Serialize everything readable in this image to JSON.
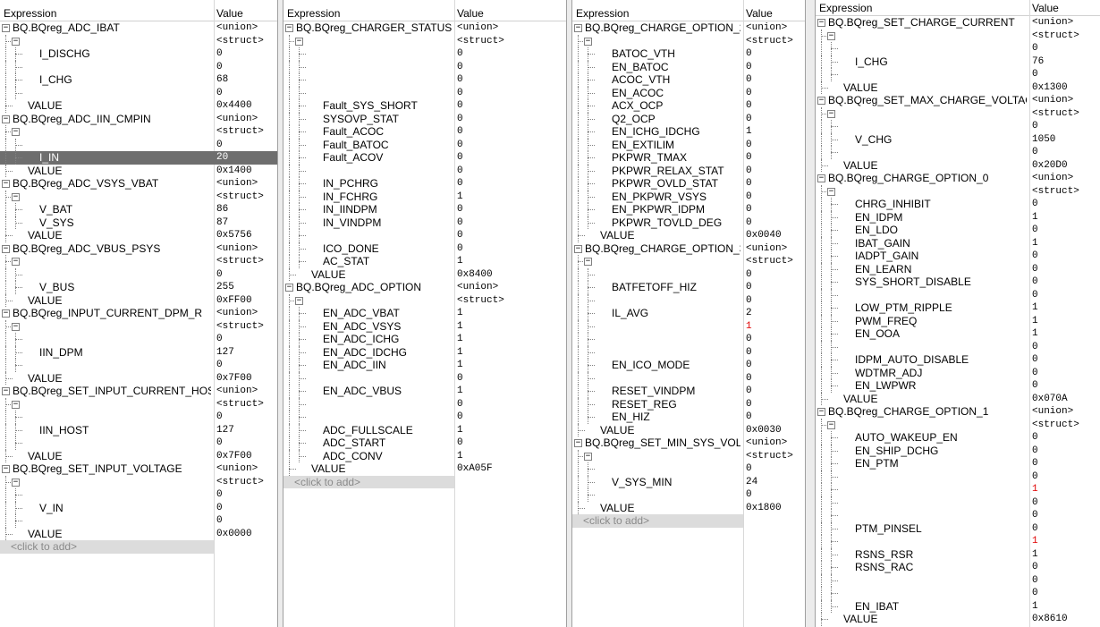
{
  "headers": {
    "expression": "Expression",
    "value": "Value"
  },
  "add_label": "<click to add>",
  "panels": [
    {
      "rows": [
        {
          "d": 0,
          "t": "g",
          "e": "BQ.BQreg_ADC_IBAT",
          "v": "<union>"
        },
        {
          "d": 1,
          "t": "g",
          "e": "",
          "v": "<struct>"
        },
        {
          "d": 2,
          "t": "l",
          "e": "I_DISCHG",
          "v": "0"
        },
        {
          "d": 2,
          "t": "l",
          "e": "",
          "v": "0"
        },
        {
          "d": 2,
          "t": "l",
          "e": "I_CHG",
          "v": "68"
        },
        {
          "d": 2,
          "t": "l",
          "e": "",
          "v": "0"
        },
        {
          "d": 1,
          "t": "l",
          "e": "VALUE",
          "v": "0x4400"
        },
        {
          "d": 0,
          "t": "g",
          "e": "BQ.BQreg_ADC_IIN_CMPIN",
          "v": "<union>"
        },
        {
          "d": 1,
          "t": "g",
          "e": "",
          "v": "<struct>"
        },
        {
          "d": 2,
          "t": "l",
          "e": "",
          "v": "0"
        },
        {
          "d": 2,
          "t": "l",
          "e": "I_IN",
          "v": "20",
          "sel": true
        },
        {
          "d": 1,
          "t": "l",
          "e": "VALUE",
          "v": "0x1400"
        },
        {
          "d": 0,
          "t": "g",
          "e": "BQ.BQreg_ADC_VSYS_VBAT",
          "v": "<union>"
        },
        {
          "d": 1,
          "t": "g",
          "e": "",
          "v": "<struct>"
        },
        {
          "d": 2,
          "t": "l",
          "e": "V_BAT",
          "v": "86"
        },
        {
          "d": 2,
          "t": "l",
          "e": "V_SYS",
          "v": "87"
        },
        {
          "d": 1,
          "t": "l",
          "e": "VALUE",
          "v": "0x5756"
        },
        {
          "d": 0,
          "t": "g",
          "e": "BQ.BQreg_ADC_VBUS_PSYS",
          "v": "<union>"
        },
        {
          "d": 1,
          "t": "g",
          "e": "",
          "v": "<struct>"
        },
        {
          "d": 2,
          "t": "l",
          "e": "",
          "v": "0"
        },
        {
          "d": 2,
          "t": "l",
          "e": "V_BUS",
          "v": "255"
        },
        {
          "d": 1,
          "t": "l",
          "e": "VALUE",
          "v": "0xFF00"
        },
        {
          "d": 0,
          "t": "g",
          "e": "BQ.BQreg_INPUT_CURRENT_DPM_R",
          "v": "<union>"
        },
        {
          "d": 1,
          "t": "g",
          "e": "",
          "v": "<struct>"
        },
        {
          "d": 2,
          "t": "l",
          "e": "",
          "v": "0"
        },
        {
          "d": 2,
          "t": "l",
          "e": "IIN_DPM",
          "v": "127"
        },
        {
          "d": 2,
          "t": "l",
          "e": "",
          "v": "0"
        },
        {
          "d": 1,
          "t": "l",
          "e": "VALUE",
          "v": "0x7F00"
        },
        {
          "d": 0,
          "t": "g",
          "e": "BQ.BQreg_SET_INPUT_CURRENT_HOST",
          "v": "<union>"
        },
        {
          "d": 1,
          "t": "g",
          "e": "",
          "v": "<struct>"
        },
        {
          "d": 2,
          "t": "l",
          "e": "",
          "v": "0"
        },
        {
          "d": 2,
          "t": "l",
          "e": "IIN_HOST",
          "v": "127"
        },
        {
          "d": 2,
          "t": "l",
          "e": "",
          "v": "0"
        },
        {
          "d": 1,
          "t": "l",
          "e": "VALUE",
          "v": "0x7F00"
        },
        {
          "d": 0,
          "t": "g",
          "e": "BQ.BQreg_SET_INPUT_VOLTAGE",
          "v": "<union>"
        },
        {
          "d": 1,
          "t": "g",
          "e": "",
          "v": "<struct>"
        },
        {
          "d": 2,
          "t": "l",
          "e": "",
          "v": "0"
        },
        {
          "d": 2,
          "t": "l",
          "e": "V_IN",
          "v": "0"
        },
        {
          "d": 2,
          "t": "l",
          "e": "",
          "v": "0"
        },
        {
          "d": 1,
          "t": "l",
          "e": "VALUE",
          "v": "0x0000"
        }
      ]
    },
    {
      "rows": [
        {
          "d": 0,
          "t": "g",
          "e": "BQ.BQreg_CHARGER_STATUS",
          "v": "<union>"
        },
        {
          "d": 1,
          "t": "g",
          "e": "",
          "v": "<struct>"
        },
        {
          "d": 2,
          "t": "l",
          "e": "",
          "v": "0"
        },
        {
          "d": 2,
          "t": "l",
          "e": "",
          "v": "0"
        },
        {
          "d": 2,
          "t": "l",
          "e": "",
          "v": "0"
        },
        {
          "d": 2,
          "t": "l",
          "e": "",
          "v": "0"
        },
        {
          "d": 2,
          "t": "l",
          "e": "Fault_SYS_SHORT",
          "v": "0"
        },
        {
          "d": 2,
          "t": "l",
          "e": "SYSOVP_STAT",
          "v": "0"
        },
        {
          "d": 2,
          "t": "l",
          "e": "Fault_ACOC",
          "v": "0"
        },
        {
          "d": 2,
          "t": "l",
          "e": "Fault_BATOC",
          "v": "0"
        },
        {
          "d": 2,
          "t": "l",
          "e": "Fault_ACOV",
          "v": "0"
        },
        {
          "d": 2,
          "t": "l",
          "e": "",
          "v": "0"
        },
        {
          "d": 2,
          "t": "l",
          "e": "IN_PCHRG",
          "v": "0"
        },
        {
          "d": 2,
          "t": "l",
          "e": "IN_FCHRG",
          "v": "1"
        },
        {
          "d": 2,
          "t": "l",
          "e": "IN_IINDPM",
          "v": "0"
        },
        {
          "d": 2,
          "t": "l",
          "e": "IN_VINDPM",
          "v": "0"
        },
        {
          "d": 2,
          "t": "l",
          "e": "",
          "v": "0"
        },
        {
          "d": 2,
          "t": "l",
          "e": "ICO_DONE",
          "v": "0"
        },
        {
          "d": 2,
          "t": "l",
          "e": "AC_STAT",
          "v": "1"
        },
        {
          "d": 1,
          "t": "l",
          "e": "VALUE",
          "v": "0x8400"
        },
        {
          "d": 0,
          "t": "g",
          "e": "BQ.BQreg_ADC_OPTION",
          "v": "<union>"
        },
        {
          "d": 1,
          "t": "g",
          "e": "",
          "v": "<struct>"
        },
        {
          "d": 2,
          "t": "l",
          "e": "EN_ADC_VBAT",
          "v": "1"
        },
        {
          "d": 2,
          "t": "l",
          "e": "EN_ADC_VSYS",
          "v": "1"
        },
        {
          "d": 2,
          "t": "l",
          "e": "EN_ADC_ICHG",
          "v": "1"
        },
        {
          "d": 2,
          "t": "l",
          "e": "EN_ADC_IDCHG",
          "v": "1"
        },
        {
          "d": 2,
          "t": "l",
          "e": "EN_ADC_IIN",
          "v": "1"
        },
        {
          "d": 2,
          "t": "l",
          "e": "",
          "v": "0"
        },
        {
          "d": 2,
          "t": "l",
          "e": "EN_ADC_VBUS",
          "v": "1"
        },
        {
          "d": 2,
          "t": "l",
          "e": "",
          "v": "0"
        },
        {
          "d": 2,
          "t": "l",
          "e": "",
          "v": "0"
        },
        {
          "d": 2,
          "t": "l",
          "e": "ADC_FULLSCALE",
          "v": "1"
        },
        {
          "d": 2,
          "t": "l",
          "e": "ADC_START",
          "v": "0"
        },
        {
          "d": 2,
          "t": "l",
          "e": "ADC_CONV",
          "v": "1"
        },
        {
          "d": 1,
          "t": "l",
          "e": "VALUE",
          "v": "0xA05F"
        }
      ]
    },
    {
      "rows": [
        {
          "d": 0,
          "t": "g",
          "e": "BQ.BQreg_CHARGE_OPTION_2",
          "v": "<union>"
        },
        {
          "d": 1,
          "t": "g",
          "e": "",
          "v": "<struct>"
        },
        {
          "d": 2,
          "t": "l",
          "e": "BATOC_VTH",
          "v": "0"
        },
        {
          "d": 2,
          "t": "l",
          "e": "EN_BATOC",
          "v": "0"
        },
        {
          "d": 2,
          "t": "l",
          "e": "ACOC_VTH",
          "v": "0"
        },
        {
          "d": 2,
          "t": "l",
          "e": "EN_ACOC",
          "v": "0"
        },
        {
          "d": 2,
          "t": "l",
          "e": "ACX_OCP",
          "v": "0"
        },
        {
          "d": 2,
          "t": "l",
          "e": "Q2_OCP",
          "v": "0"
        },
        {
          "d": 2,
          "t": "l",
          "e": "EN_ICHG_IDCHG",
          "v": "1"
        },
        {
          "d": 2,
          "t": "l",
          "e": "EN_EXTILIM",
          "v": "0"
        },
        {
          "d": 2,
          "t": "l",
          "e": "PKPWR_TMAX",
          "v": "0"
        },
        {
          "d": 2,
          "t": "l",
          "e": "PKPWR_RELAX_STAT",
          "v": "0"
        },
        {
          "d": 2,
          "t": "l",
          "e": "PKPWR_OVLD_STAT",
          "v": "0"
        },
        {
          "d": 2,
          "t": "l",
          "e": "EN_PKPWR_VSYS",
          "v": "0"
        },
        {
          "d": 2,
          "t": "l",
          "e": "EN_PKPWR_IDPM",
          "v": "0"
        },
        {
          "d": 2,
          "t": "l",
          "e": "PKPWR_TOVLD_DEG",
          "v": "0"
        },
        {
          "d": 1,
          "t": "l",
          "e": "VALUE",
          "v": "0x0040"
        },
        {
          "d": 0,
          "t": "g",
          "e": "BQ.BQreg_CHARGE_OPTION_3",
          "v": "<union>"
        },
        {
          "d": 1,
          "t": "g",
          "e": "",
          "v": "<struct>"
        },
        {
          "d": 2,
          "t": "l",
          "e": "",
          "v": "0"
        },
        {
          "d": 2,
          "t": "l",
          "e": "BATFETOFF_HIZ",
          "v": "0"
        },
        {
          "d": 2,
          "t": "l",
          "e": "",
          "v": "0"
        },
        {
          "d": 2,
          "t": "l",
          "e": "IL_AVG",
          "v": "2"
        },
        {
          "d": 2,
          "t": "l",
          "e": "",
          "v": "1",
          "red": true
        },
        {
          "d": 2,
          "t": "l",
          "e": "",
          "v": "0"
        },
        {
          "d": 2,
          "t": "l",
          "e": "",
          "v": "0"
        },
        {
          "d": 2,
          "t": "l",
          "e": "EN_ICO_MODE",
          "v": "0"
        },
        {
          "d": 2,
          "t": "l",
          "e": "",
          "v": "0"
        },
        {
          "d": 2,
          "t": "l",
          "e": "RESET_VINDPM",
          "v": "0"
        },
        {
          "d": 2,
          "t": "l",
          "e": "RESET_REG",
          "v": "0"
        },
        {
          "d": 2,
          "t": "l",
          "e": "EN_HIZ",
          "v": "0"
        },
        {
          "d": 1,
          "t": "l",
          "e": "VALUE",
          "v": "0x0030"
        },
        {
          "d": 0,
          "t": "g",
          "e": "BQ.BQreg_SET_MIN_SYS_VOL...",
          "v": "<union>"
        },
        {
          "d": 1,
          "t": "g",
          "e": "",
          "v": "<struct>"
        },
        {
          "d": 2,
          "t": "l",
          "e": "",
          "v": "0"
        },
        {
          "d": 2,
          "t": "l",
          "e": "V_SYS_MIN",
          "v": "24"
        },
        {
          "d": 2,
          "t": "l",
          "e": "",
          "v": "0"
        },
        {
          "d": 1,
          "t": "l",
          "e": "VALUE",
          "v": "0x1800"
        }
      ]
    },
    {
      "rows": [
        {
          "d": 0,
          "t": "g",
          "e": "BQ.BQreg_SET_CHARGE_CURRENT",
          "v": "<union>"
        },
        {
          "d": 1,
          "t": "g",
          "e": "",
          "v": "<struct>"
        },
        {
          "d": 2,
          "t": "l",
          "e": "",
          "v": "0"
        },
        {
          "d": 2,
          "t": "l",
          "e": "I_CHG",
          "v": "76"
        },
        {
          "d": 2,
          "t": "l",
          "e": "",
          "v": "0"
        },
        {
          "d": 1,
          "t": "l",
          "e": "VALUE",
          "v": "0x1300"
        },
        {
          "d": 0,
          "t": "g",
          "e": "BQ.BQreg_SET_MAX_CHARGE_VOLTAGE",
          "v": "<union>"
        },
        {
          "d": 1,
          "t": "g",
          "e": "",
          "v": "<struct>"
        },
        {
          "d": 2,
          "t": "l",
          "e": "",
          "v": "0"
        },
        {
          "d": 2,
          "t": "l",
          "e": "V_CHG",
          "v": "1050"
        },
        {
          "d": 2,
          "t": "l",
          "e": "",
          "v": "0"
        },
        {
          "d": 1,
          "t": "l",
          "e": "VALUE",
          "v": "0x20D0"
        },
        {
          "d": 0,
          "t": "g",
          "e": "BQ.BQreg_CHARGE_OPTION_0",
          "v": "<union>"
        },
        {
          "d": 1,
          "t": "g",
          "e": "",
          "v": "<struct>"
        },
        {
          "d": 2,
          "t": "l",
          "e": "CHRG_INHIBIT",
          "v": "0"
        },
        {
          "d": 2,
          "t": "l",
          "e": "EN_IDPM",
          "v": "1"
        },
        {
          "d": 2,
          "t": "l",
          "e": "EN_LDO",
          "v": "0"
        },
        {
          "d": 2,
          "t": "l",
          "e": "IBAT_GAIN",
          "v": "1"
        },
        {
          "d": 2,
          "t": "l",
          "e": "IADPT_GAIN",
          "v": "0"
        },
        {
          "d": 2,
          "t": "l",
          "e": "EN_LEARN",
          "v": "0"
        },
        {
          "d": 2,
          "t": "l",
          "e": "SYS_SHORT_DISABLE",
          "v": "0"
        },
        {
          "d": 2,
          "t": "l",
          "e": "",
          "v": "0"
        },
        {
          "d": 2,
          "t": "l",
          "e": "LOW_PTM_RIPPLE",
          "v": "1"
        },
        {
          "d": 2,
          "t": "l",
          "e": "PWM_FREQ",
          "v": "1"
        },
        {
          "d": 2,
          "t": "l",
          "e": "EN_OOA",
          "v": "1"
        },
        {
          "d": 2,
          "t": "l",
          "e": "",
          "v": "0"
        },
        {
          "d": 2,
          "t": "l",
          "e": "IDPM_AUTO_DISABLE",
          "v": "0"
        },
        {
          "d": 2,
          "t": "l",
          "e": "WDTMR_ADJ",
          "v": "0"
        },
        {
          "d": 2,
          "t": "l",
          "e": "EN_LWPWR",
          "v": "0"
        },
        {
          "d": 1,
          "t": "l",
          "e": "VALUE",
          "v": "0x070A"
        },
        {
          "d": 0,
          "t": "g",
          "e": "BQ.BQreg_CHARGE_OPTION_1",
          "v": "<union>"
        },
        {
          "d": 1,
          "t": "g",
          "e": "",
          "v": "<struct>"
        },
        {
          "d": 2,
          "t": "l",
          "e": "AUTO_WAKEUP_EN",
          "v": "0"
        },
        {
          "d": 2,
          "t": "l",
          "e": "EN_SHIP_DCHG",
          "v": "0"
        },
        {
          "d": 2,
          "t": "l",
          "e": "EN_PTM",
          "v": "0"
        },
        {
          "d": 2,
          "t": "l",
          "e": "",
          "v": "0"
        },
        {
          "d": 2,
          "t": "l",
          "e": "",
          "v": "1",
          "red": true
        },
        {
          "d": 2,
          "t": "l",
          "e": "",
          "v": "0"
        },
        {
          "d": 2,
          "t": "l",
          "e": "",
          "v": "0"
        },
        {
          "d": 2,
          "t": "l",
          "e": "PTM_PINSEL",
          "v": "0"
        },
        {
          "d": 2,
          "t": "l",
          "e": "",
          "v": "1",
          "red": true
        },
        {
          "d": 2,
          "t": "l",
          "e": "RSNS_RSR",
          "v": "1"
        },
        {
          "d": 2,
          "t": "l",
          "e": "RSNS_RAC",
          "v": "0"
        },
        {
          "d": 2,
          "t": "l",
          "e": "",
          "v": "0"
        },
        {
          "d": 2,
          "t": "l",
          "e": "",
          "v": "0"
        },
        {
          "d": 2,
          "t": "l",
          "e": "EN_IBAT",
          "v": "1"
        },
        {
          "d": 1,
          "t": "l",
          "e": "VALUE",
          "v": "0x8610"
        }
      ]
    }
  ]
}
